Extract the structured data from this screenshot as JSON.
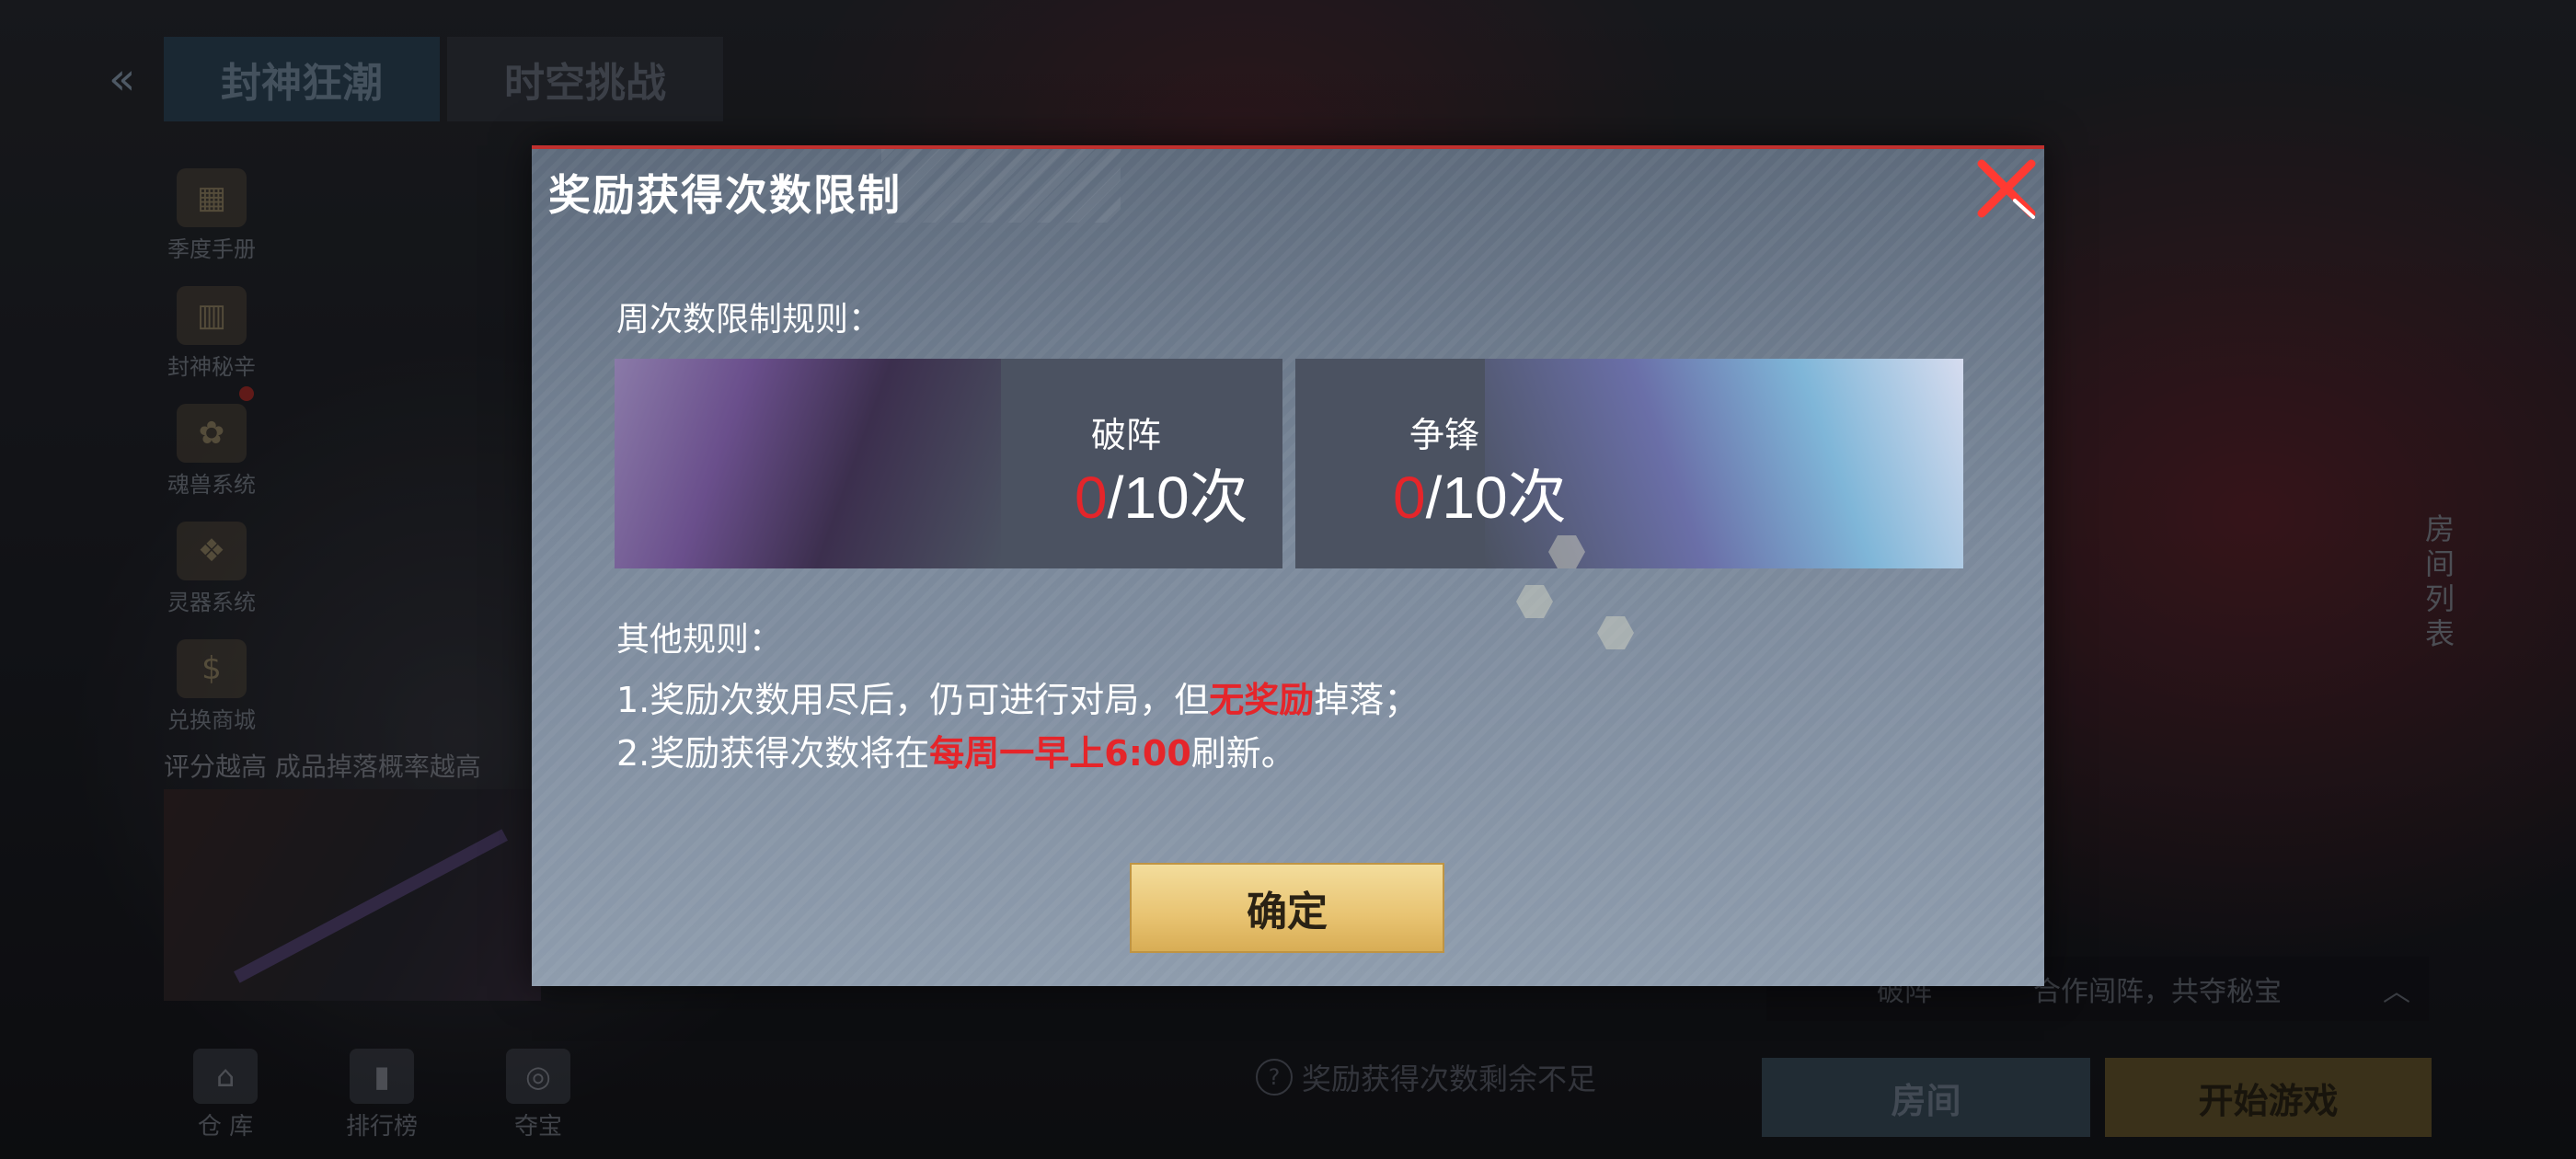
{
  "background": {
    "top_tabs": [
      "封神狂潮",
      "时空挑战"
    ],
    "side_menu": [
      {
        "label": "季度手册",
        "icon": "book-icon"
      },
      {
        "label": "封神秘辛",
        "icon": "scroll-icon"
      },
      {
        "label": "魂兽系统",
        "icon": "beast-icon"
      },
      {
        "label": "灵器系统",
        "icon": "artifact-icon"
      },
      {
        "label": "兑换商城",
        "icon": "dollar-icon"
      }
    ],
    "score_hint": "评分越高 成品掉落概率越高",
    "bottom_nav": [
      {
        "label": "仓 库",
        "icon": "warehouse-icon"
      },
      {
        "label": "排行榜",
        "icon": "ranking-icon"
      },
      {
        "label": "夺宝",
        "icon": "treasure-icon"
      }
    ],
    "room_list_label": "房间列表",
    "dropdown": {
      "mode": "破阵",
      "desc": "合作闯阵，共夺秘宝"
    },
    "rewards_remaining_hint": "奖励获得次数剩余不足",
    "room_button": "房间",
    "start_button": "开始游戏"
  },
  "modal": {
    "title": "奖励获得次数限制",
    "weekly_rules_title": "周次数限制规则：",
    "cards": [
      {
        "name": "破阵",
        "used": "0",
        "limit": "/10次"
      },
      {
        "name": "争锋",
        "used": "0",
        "limit": "/10次"
      }
    ],
    "other_rules_title": "其他规则：",
    "rule1": {
      "prefix": "1.奖励次数用尽后，仍可进行对局，但",
      "highlight": "无奖励",
      "suffix": "掉落；"
    },
    "rule2": {
      "prefix": "2.奖励获得次数将在",
      "highlight": "每周一早上6:00",
      "suffix": "刷新。"
    },
    "confirm_button": "确定"
  },
  "colors": {
    "highlight_red": "#e5252a",
    "confirm_gold": "#e8c371",
    "modal_border": "#c0302e"
  }
}
